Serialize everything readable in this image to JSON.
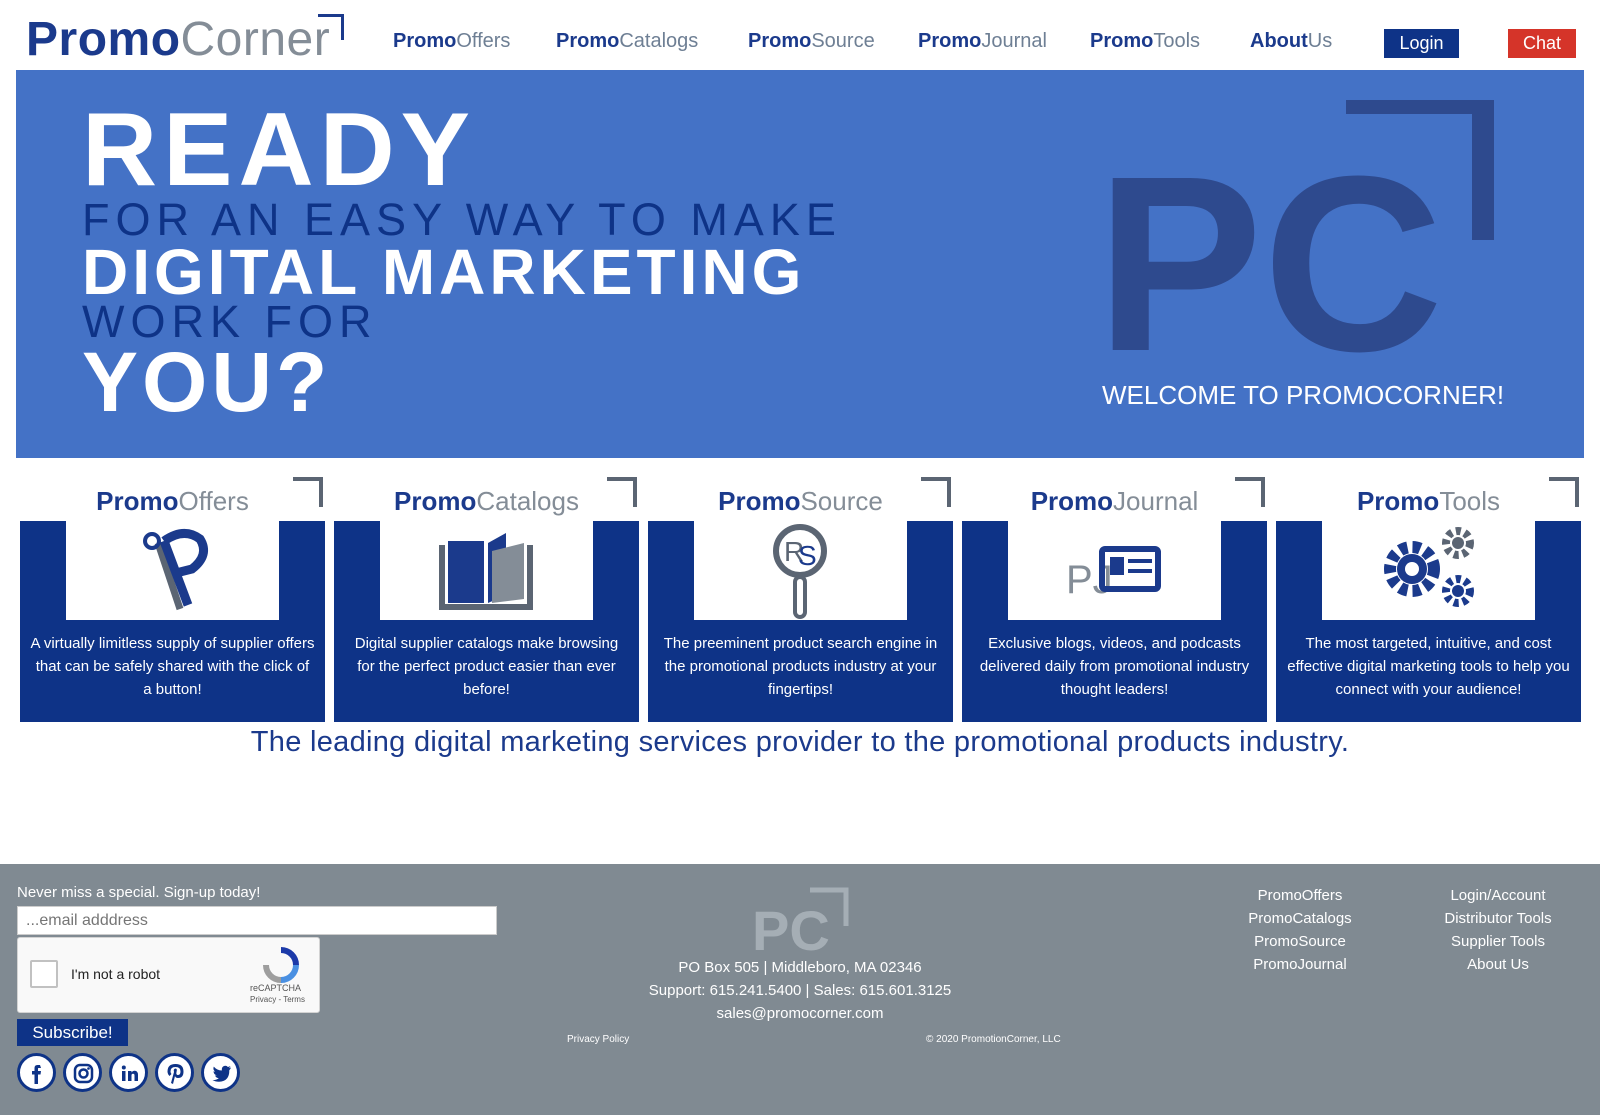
{
  "header": {
    "logo": {
      "bold": "Promo",
      "light": "Corner"
    },
    "nav": [
      {
        "bold": "Promo",
        "light": "Offers"
      },
      {
        "bold": "Promo",
        "light": "Catalogs"
      },
      {
        "bold": "Promo",
        "light": "Source"
      },
      {
        "bold": "Promo",
        "light": "Journal"
      },
      {
        "bold": "Promo",
        "light": "Tools"
      },
      {
        "bold": "About",
        "light": "Us"
      }
    ],
    "login_label": "Login",
    "chat_label": "Chat",
    "colors": {
      "primary": "#1b3a8c",
      "secondary_text": "#848d97",
      "chat": "#d53429",
      "login": "#0e3387"
    }
  },
  "hero": {
    "line_ready": "READY",
    "line_easy": "FOR AN EASY WAY TO MAKE",
    "line_digital": "DIGITAL MARKETING",
    "line_work": "WORK FOR",
    "line_you": "YOU?",
    "welcome": "WELCOME TO PROMOCORNER!",
    "mark": "PC",
    "background": "#4472c6"
  },
  "cards": [
    {
      "bold": "Promo",
      "light": "Offers",
      "icon": "promo-offers-icon",
      "desc": "A virtually limitless supply of supplier offers that can be safely shared with the click of a button!"
    },
    {
      "bold": "Promo",
      "light": "Catalogs",
      "icon": "open-book-icon",
      "desc": "Digital supplier catalogs make browsing for the perfect product easier than ever before!"
    },
    {
      "bold": "Promo",
      "light": "Source",
      "icon": "magnifier-icon",
      "desc": "The preeminent product search engine in the promotional products industry at your fingertips!"
    },
    {
      "bold": "Promo",
      "light": "Journal",
      "icon": "journal-icon",
      "desc": "Exclusive blogs, videos, and podcasts delivered daily from promotional industry thought leaders!"
    },
    {
      "bold": "Promo",
      "light": "Tools",
      "icon": "gears-icon",
      "desc": "The most targeted, intuitive, and cost effective digital marketing tools to help you connect with your audience!"
    }
  ],
  "tagline": "The leading digital marketing services provider to the promotional products industry.",
  "footer": {
    "signup_text": "Never miss a special. Sign-up today!",
    "email_placeholder": "...email adddress",
    "captcha_label": "I'm not a robot",
    "captcha_brand": "reCAPTCHA",
    "captcha_links": "Privacy - Terms",
    "subscribe_label": "Subscribe!",
    "social": [
      "facebook-icon",
      "instagram-icon",
      "linkedin-icon",
      "pinterest-icon",
      "twitter-icon"
    ],
    "logo": "PC",
    "address": "PO Box 505 | Middleboro, MA 02346",
    "phones": "Support: 615.241.5400 | Sales: 615.601.3125",
    "email": "sales@promocorner.com",
    "privacy": "Privacy Policy",
    "copyright": "© 2020 PromotionCorner, LLC",
    "links_col1": [
      "PromoOffers",
      "PromoCatalogs",
      "PromoSource",
      "PromoJournal"
    ],
    "links_col2": [
      "Login/Account",
      "Distributor Tools",
      "Supplier Tools",
      "About Us"
    ],
    "background": "#808a92"
  }
}
